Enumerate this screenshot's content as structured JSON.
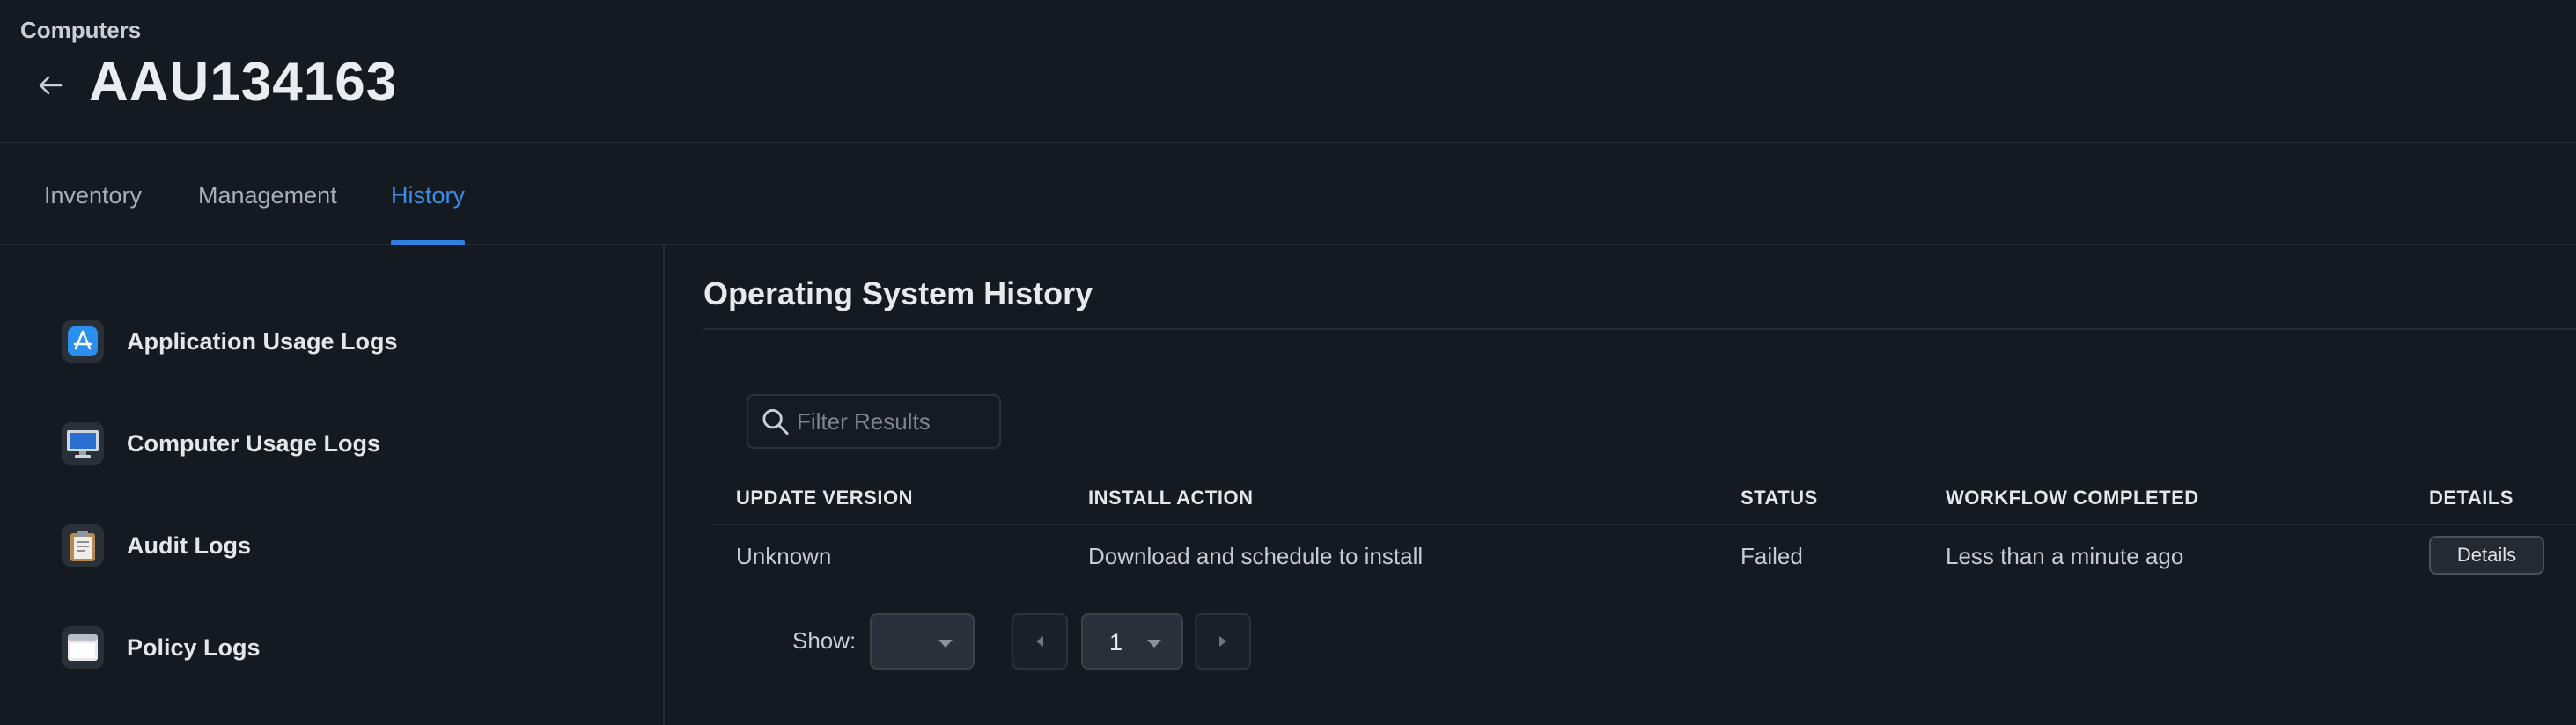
{
  "header": {
    "breadcrumb": "Computers",
    "title": "AAU134163"
  },
  "tabs": [
    {
      "label": "Inventory"
    },
    {
      "label": "Management"
    },
    {
      "label": "History"
    }
  ],
  "sidebar": {
    "items": [
      {
        "label": "Application Usage Logs",
        "icon": "app-store-icon"
      },
      {
        "label": "Computer Usage Logs",
        "icon": "computer-monitor-icon"
      },
      {
        "label": "Audit Logs",
        "icon": "clipboard-icon"
      },
      {
        "label": "Policy Logs",
        "icon": "window-icon"
      }
    ]
  },
  "main": {
    "title": "Operating System History",
    "filter": {
      "placeholder": "Filter Results",
      "value": ""
    },
    "table": {
      "columns": [
        "UPDATE VERSION",
        "INSTALL ACTION",
        "STATUS",
        "WORKFLOW COMPLETED",
        "DETAILS"
      ],
      "rows": [
        {
          "update_version": "Unknown",
          "install_action": "Download and schedule to install",
          "status": "Failed",
          "workflow_completed": "Less than a minute ago",
          "details_label": "Details"
        }
      ]
    },
    "pagination": {
      "show_label": "Show:",
      "page_size": "",
      "current_page": "1"
    }
  },
  "colors": {
    "accent": "#2f7fe0",
    "background": "#151a21",
    "border": "#262c36"
  }
}
